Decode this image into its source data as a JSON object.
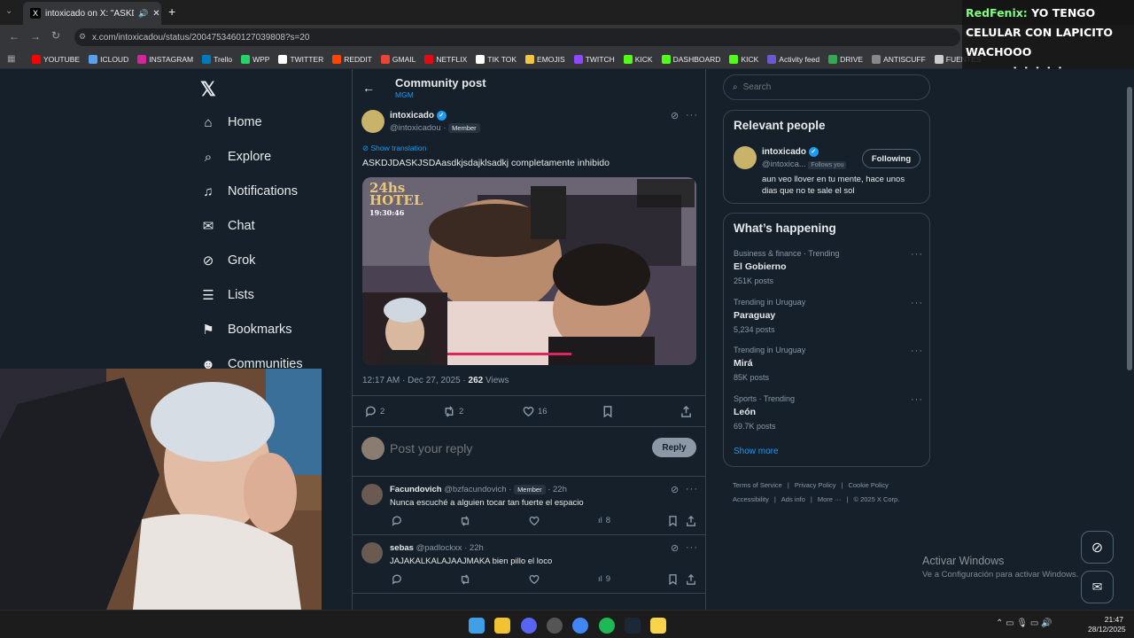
{
  "browser": {
    "tab_title": "intoxicado on X: \"ASKDJDASKJ",
    "url": "x.com/intoxicadou/status/2004753460127039808?s=20",
    "bookmarks": [
      {
        "label": "YOUTUBE",
        "color": "#ff0000"
      },
      {
        "label": "ICLOUD",
        "color": "#5aa0f0"
      },
      {
        "label": "INSTAGRAM",
        "color": "#d6249f"
      },
      {
        "label": "Trello",
        "color": "#0079bf"
      },
      {
        "label": "WPP",
        "color": "#25d366"
      },
      {
        "label": "TWITTER",
        "color": "#ffffff"
      },
      {
        "label": "REDDIT",
        "color": "#ff4500"
      },
      {
        "label": "GMAIL",
        "color": "#ea4335"
      },
      {
        "label": "NETFLIX",
        "color": "#e50914"
      },
      {
        "label": "TIK TOK",
        "color": "#ffffff"
      },
      {
        "label": "EMOJIS",
        "color": "#f4c542"
      },
      {
        "label": "TWITCH",
        "color": "#9146ff"
      },
      {
        "label": "KICK",
        "color": "#53fc18"
      },
      {
        "label": "DASHBOARD",
        "color": "#53fc18"
      },
      {
        "label": "KICK",
        "color": "#53fc18"
      },
      {
        "label": "Activity feed",
        "color": "#6a5acd"
      },
      {
        "label": "DRIVE",
        "color": "#34a853"
      },
      {
        "label": "ANTISCUFF",
        "color": "#888888"
      },
      {
        "label": "FUENTES",
        "color": "#cccccc"
      }
    ]
  },
  "chat_overlay": {
    "line1_user": "RedFenix:",
    "line1_msg": "YO TENGO",
    "line2": "CELULAR CON LAPICITO",
    "line3": "WACHOOO",
    "line4_user": "sumzs:",
    "line4_msg": "jajajajaj"
  },
  "sidebar": {
    "items": [
      {
        "label": "Home",
        "icon": "home-icon"
      },
      {
        "label": "Explore",
        "icon": "search-icon"
      },
      {
        "label": "Notifications",
        "icon": "bell-icon"
      },
      {
        "label": "Chat",
        "icon": "mail-icon"
      },
      {
        "label": "Grok",
        "icon": "grok-icon"
      },
      {
        "label": "Lists",
        "icon": "list-icon"
      },
      {
        "label": "Bookmarks",
        "icon": "bookmark-icon"
      },
      {
        "label": "Communities",
        "icon": "people-icon"
      }
    ]
  },
  "post": {
    "header_title": "Community post",
    "header_sub": "MGM",
    "author_name": "intoxicado",
    "author_handle": "@intoxicadou",
    "member_badge": "Member",
    "show_translation": "Show translation",
    "text": "ASKDJDASKJSDAasdkjsdajklsadkj completamente inhibido",
    "media_overlay_title": "24hs",
    "media_overlay_sub": "HOTEL",
    "media_time": "19:30:46",
    "timestamp": "12:17 AM · Dec 27, 2025 ·",
    "views_count": "262",
    "views_label": "Views",
    "replies": "2",
    "reposts": "2",
    "likes": "16",
    "reply_placeholder": "Post your reply",
    "reply_button": "Reply"
  },
  "replies": [
    {
      "name": "Facundovich",
      "handle": "@bzfacundovich ·",
      "badge": "Member",
      "time": "· 22h",
      "text": "Nunca escuché a alguien tocar tan fuerte el espacio",
      "views": "8"
    },
    {
      "name": "sebas",
      "handle": "@padlockxx ·",
      "badge": "",
      "time": "22h",
      "text": "JAJAKALKALAJAAJMAKA bien pillo el loco",
      "views": "9"
    }
  ],
  "right": {
    "search_placeholder": "Search",
    "relevant_title": "Relevant people",
    "person_name": "intoxicado",
    "person_handle": "@intoxica...",
    "follows_you": "Follows you",
    "following_button": "Following",
    "bio": "aun veo llover en tu mente, hace unos dias que no te sale el sol",
    "happening_title": "What’s happening",
    "trends": [
      {
        "category": "Business & finance · Trending",
        "name": "El Gobierno",
        "count": "251K posts"
      },
      {
        "category": "Trending in Uruguay",
        "name": "Paraguay",
        "count": "5,234 posts"
      },
      {
        "category": "Trending in Uruguay",
        "name": "Mirá",
        "count": "85K posts"
      },
      {
        "category": "Sports · Trending",
        "name": "León",
        "count": "69.7K posts"
      }
    ],
    "show_more": "Show more",
    "footer_line1": [
      "Terms of Service",
      "Privacy Policy",
      "Cookie Policy"
    ],
    "footer_line2": [
      "Accessibility",
      "Ads info",
      "More ···",
      "© 2025 X Corp."
    ]
  },
  "windows": {
    "activate_title": "Activar Windows",
    "activate_sub": "Ve a Configuración para activar Windows.",
    "clock_time": "21:47",
    "clock_date": "28/12/2025"
  },
  "colors": {
    "background": "#15202b",
    "accent": "#1d9bf0",
    "border": "#38444d"
  }
}
